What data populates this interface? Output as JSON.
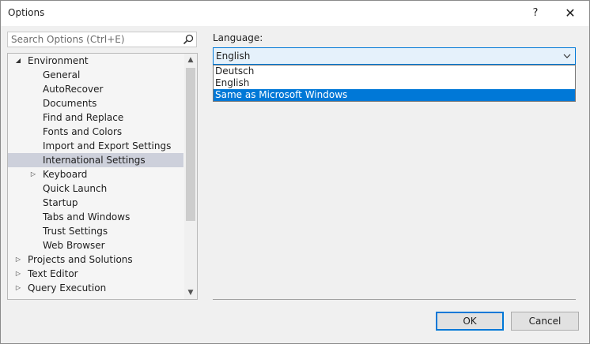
{
  "window": {
    "title": "Options",
    "help_label": "?",
    "close_label": "✕"
  },
  "search": {
    "placeholder": "Search Options (Ctrl+E)"
  },
  "tree": {
    "items": [
      {
        "label": "Environment",
        "expander": "expanded"
      },
      {
        "label": "General"
      },
      {
        "label": "AutoRecover"
      },
      {
        "label": "Documents"
      },
      {
        "label": "Find and Replace"
      },
      {
        "label": "Fonts and Colors"
      },
      {
        "label": "Import and Export Settings"
      },
      {
        "label": "International Settings",
        "selected": true
      },
      {
        "label": "Keyboard",
        "expander": "collapsed"
      },
      {
        "label": "Quick Launch"
      },
      {
        "label": "Startup"
      },
      {
        "label": "Tabs and Windows"
      },
      {
        "label": "Trust Settings"
      },
      {
        "label": "Web Browser"
      },
      {
        "label": "Projects and Solutions",
        "expander": "collapsed"
      },
      {
        "label": "Text Editor",
        "expander": "collapsed"
      },
      {
        "label": "Query Execution",
        "expander": "collapsed"
      }
    ]
  },
  "language": {
    "label": "Language:",
    "selected": "English",
    "options": [
      "Deutsch",
      "English",
      "Same as Microsoft Windows"
    ],
    "highlighted_option": "Same as Microsoft Windows"
  },
  "buttons": {
    "ok": "OK",
    "cancel": "Cancel"
  },
  "colors": {
    "accent": "#0078d7",
    "selection": "#cdd0db",
    "dialog_bg": "#f0f0f0"
  }
}
